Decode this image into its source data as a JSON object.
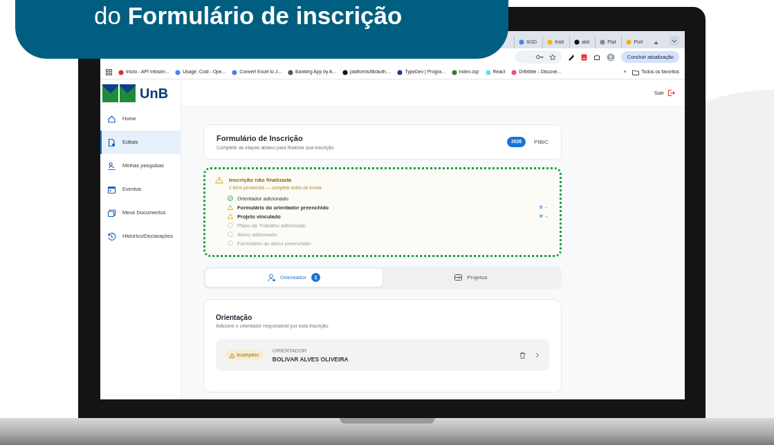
{
  "banner": {
    "text": "do **Formulário de inscrição**"
  },
  "browser": {
    "tabs": [
      {
        "label": "SGD",
        "selected": false
      },
      {
        "label": "Insti",
        "selected": false
      },
      {
        "label": "alet",
        "selected": false
      },
      {
        "label": "Plat",
        "selected": false
      },
      {
        "label": "Port",
        "selected": false
      }
    ],
    "new_tab": "+",
    "update_button": "Concluir atualização",
    "bookmarks": [
      "Início - API Infosim...",
      "Usage: Cost - Ope...",
      "Convert Excel to J...",
      "Banking App by A...",
      "platforms/lib/auth....",
      "TypeDev | Progra...",
      "index.csp",
      "React",
      "Dribbble - Discove..."
    ],
    "bookmarks_overflow": "»",
    "all_bookmarks": "Todos os favoritos"
  },
  "app": {
    "logo_text": "UnB",
    "sidebar": {
      "items": [
        {
          "label": "Home",
          "selected": false
        },
        {
          "label": "Editais",
          "selected": true
        },
        {
          "label": "Minhas pesquisas",
          "selected": false
        },
        {
          "label": "Eventos",
          "selected": false
        },
        {
          "label": "Meus Documentos",
          "selected": false
        },
        {
          "label": "Histórico/Declarações",
          "selected": false
        }
      ]
    },
    "header": {
      "logout": "Sair"
    },
    "form_card": {
      "title": "Formulário de Inscrição",
      "subtitle": "Complete as etapas abaixo para finalizar sua inscrição",
      "year_badge": "2026",
      "program": "PIBIC"
    },
    "alert": {
      "title": "Inscrição não finalizada",
      "subtitle": "2 itens pendentes — complete antes de enviar",
      "items": [
        {
          "label": "Orientador adicionado",
          "kind": "done"
        },
        {
          "label": "Formulário do orientador preenchido",
          "kind": "warning",
          "action": "Ir →"
        },
        {
          "label": "Projeto vinculado",
          "kind": "warning",
          "action": "Ir →"
        },
        {
          "label": "Plano de Trabalho adicionado",
          "kind": "pending"
        },
        {
          "label": "Aluno adicionado",
          "kind": "pending"
        },
        {
          "label": "Formulário do aluno preenchido",
          "kind": "pending"
        }
      ]
    },
    "tabs": [
      {
        "label": "Orientador",
        "selected": true,
        "count": "1"
      },
      {
        "label": "Projetos",
        "selected": false
      }
    ],
    "section": {
      "title": "Orientação",
      "subtitle": "Adicione o orientador responsável por esta inscrição",
      "advisor": {
        "status": "Incompleto",
        "role": "ORIENTADOR",
        "name": "BOLIVAR ALVES OLIVEIRA"
      }
    }
  }
}
